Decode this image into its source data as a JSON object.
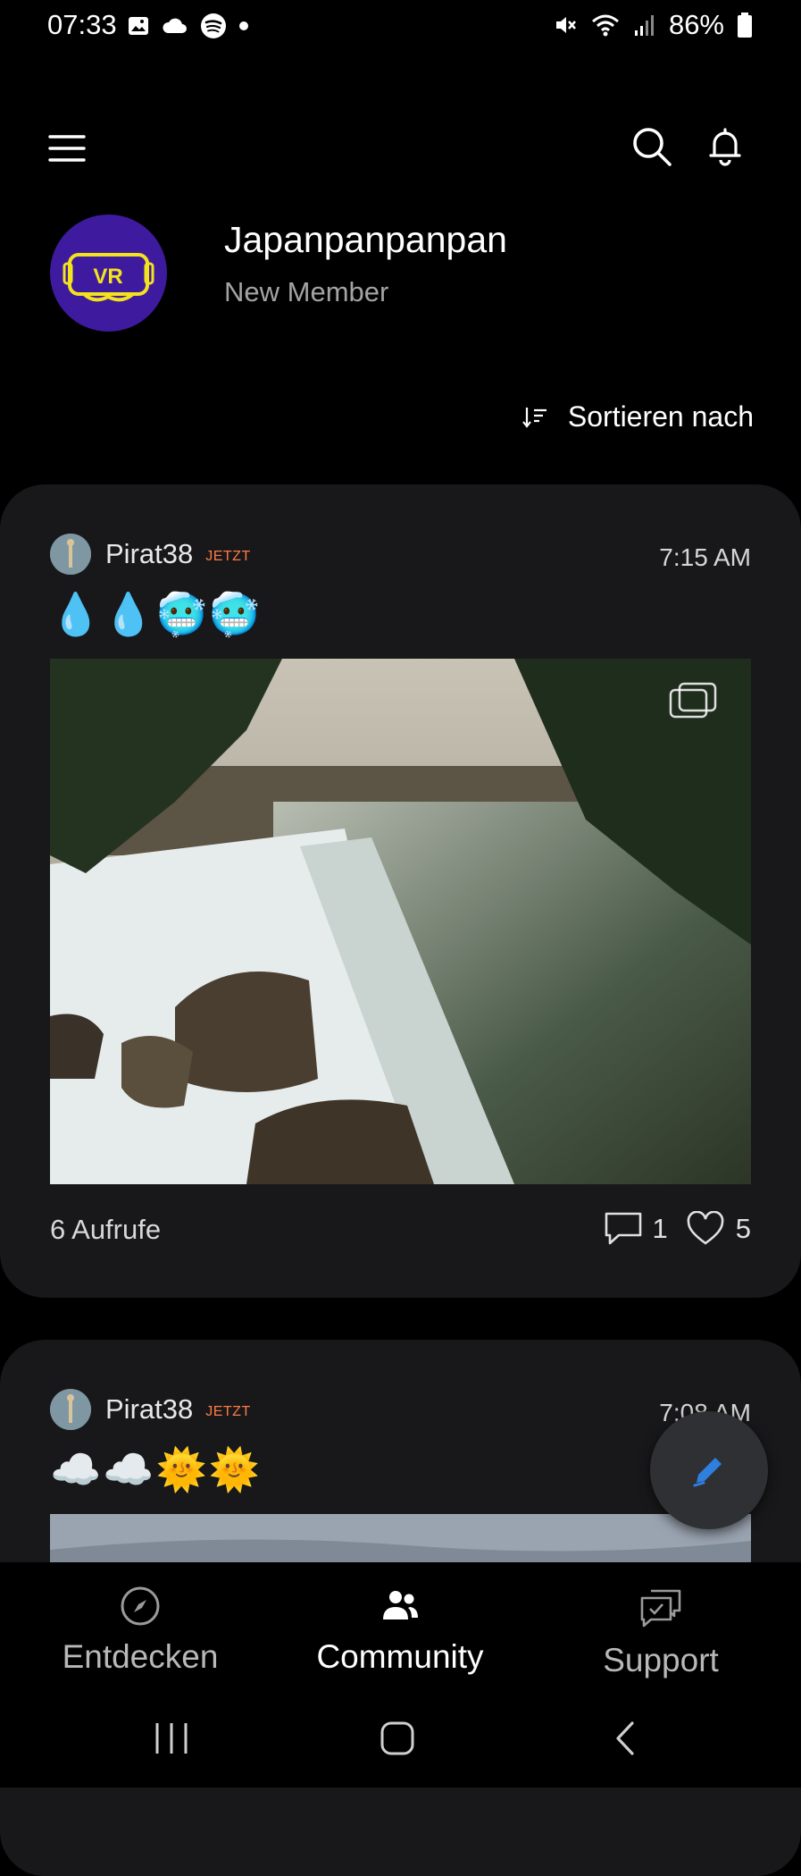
{
  "status_bar": {
    "time": "07:33",
    "left_icons": [
      "gallery-icon",
      "cloud-icon",
      "spotify-icon",
      "dot-icon"
    ],
    "right_icons": [
      "mute-icon",
      "wifi-icon",
      "signal-icon",
      "battery-icon"
    ],
    "battery": "86%"
  },
  "profile": {
    "name": "Japanpanpanpan",
    "rank": "New Member",
    "avatar_text": "VR"
  },
  "sort": {
    "label": "Sortieren nach"
  },
  "posts": [
    {
      "author": "Pirat38",
      "badge": "JETZT",
      "time": "7:15 AM",
      "emojis": "💧💧🥶🥶",
      "views": "6 Aufrufe",
      "comments": "1",
      "likes": "5"
    },
    {
      "author": "Pirat38",
      "badge": "JETZT",
      "time": "7:08 AM",
      "emojis": "☁️☁️🌞🌞"
    }
  ],
  "bottom_nav": {
    "items": [
      {
        "label": "Entdecken",
        "icon": "compass-icon",
        "active": false
      },
      {
        "label": "Community",
        "icon": "people-icon",
        "active": true
      },
      {
        "label": "Support",
        "icon": "chat-check-icon",
        "active": false
      }
    ]
  },
  "colors": {
    "background": "#000000",
    "card": "#18181a",
    "badge": "#ff7a45",
    "fab_icon": "#2f7fe0",
    "avatar_bg": "#3d1a9e",
    "avatar_neon": "#f4e21b"
  }
}
